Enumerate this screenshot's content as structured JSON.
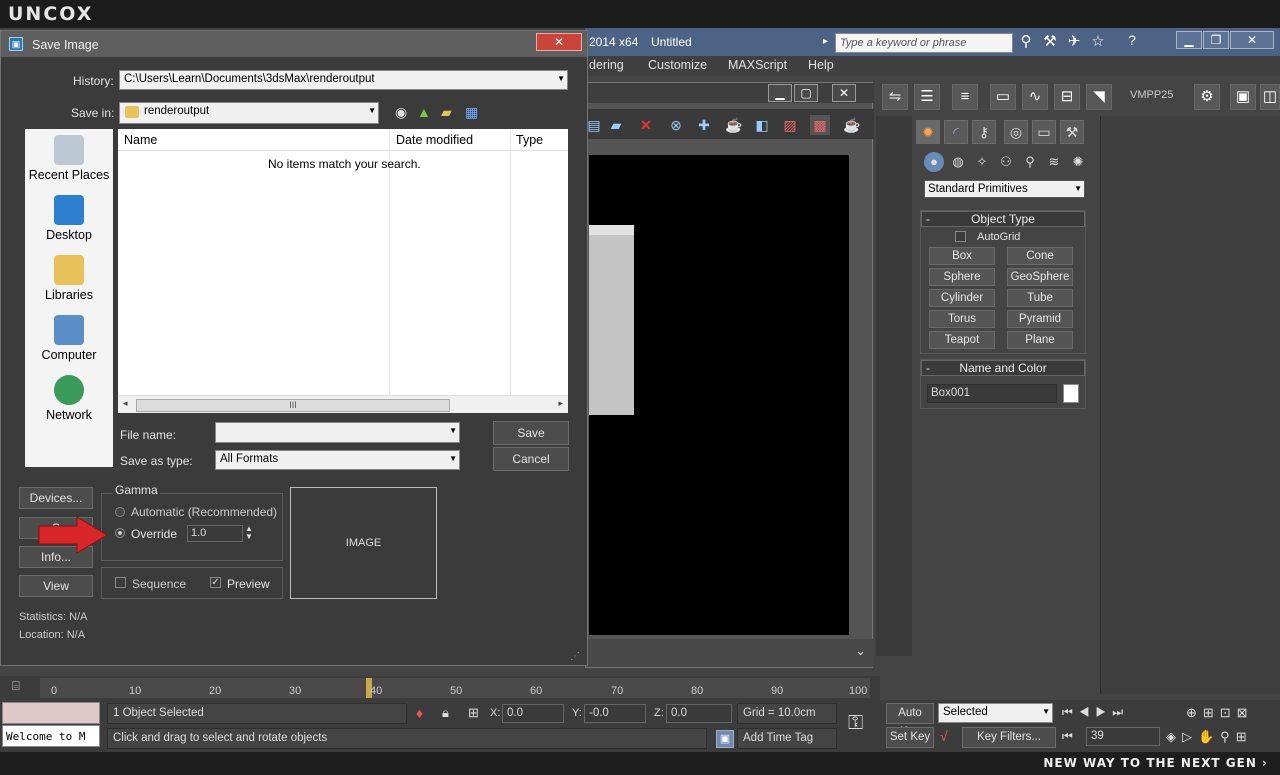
{
  "brand": "UNCOX",
  "slogan": "NEW WAY TO THE NEXT GEN",
  "app": {
    "version": "2014 x64",
    "doc": "Untitled",
    "search_placeholder": "Type a keyword or phrase",
    "menu": [
      "dering",
      "Customize",
      "MAXScript",
      "Help"
    ],
    "vmpp": "VMPP25"
  },
  "dialog": {
    "title": "Save Image",
    "history_label": "History:",
    "history_value": "C:\\Users\\Learn\\Documents\\3dsMax\\renderoutput",
    "savein_label": "Save in:",
    "savein_value": "renderoutput",
    "places": [
      "Recent Places",
      "Desktop",
      "Libraries",
      "Computer",
      "Network"
    ],
    "columns": [
      "Name",
      "Date modified",
      "Type"
    ],
    "empty_msg": "No items match your search.",
    "filename_label": "File name:",
    "filename_value": "",
    "saveas_label": "Save as type:",
    "saveas_value": "All Formats",
    "save_btn": "Save",
    "cancel_btn": "Cancel",
    "devices_btn": "Devices...",
    "setup_btn": "S",
    "info_btn": "Info...",
    "view_btn": "View",
    "gamma_title": "Gamma",
    "gamma_auto": "Automatic (Recommended)",
    "gamma_override": "Override",
    "gamma_value": "1.0",
    "sequence": "Sequence",
    "preview": "Preview",
    "image_label": "IMAGE",
    "statistics": "Statistics:  N/A",
    "location": "Location:  N/A"
  },
  "cmd": {
    "dropdown": "Standard Primitives",
    "objtype": "Object Type",
    "autogrid": "AutoGrid",
    "buttons": [
      "Box",
      "Cone",
      "Sphere",
      "GeoSphere",
      "Cylinder",
      "Tube",
      "Torus",
      "Pyramid",
      "Teapot",
      "Plane"
    ],
    "namecolor": "Name and Color",
    "objname": "Box001",
    "collapse": "-"
  },
  "timeline": {
    "ticks": [
      "0",
      "10",
      "20",
      "30",
      "40",
      "50",
      "60",
      "70",
      "80",
      "90",
      "100"
    ]
  },
  "status": {
    "selected": "1 Object Selected",
    "hint": "Click and drag to select and rotate objects",
    "listener": "Welcome to M",
    "x_label": "X:",
    "x": "0.0",
    "y_label": "Y:",
    "y": "-0.0",
    "z_label": "Z:",
    "z": "0.0",
    "grid": "Grid = 10.0cm",
    "add_time_tag": "Add Time Tag",
    "auto_key": "Auto Key",
    "set_key": "Set Key",
    "selected_dd": "Selected",
    "key_filters": "Key Filters...",
    "frame": "39"
  }
}
